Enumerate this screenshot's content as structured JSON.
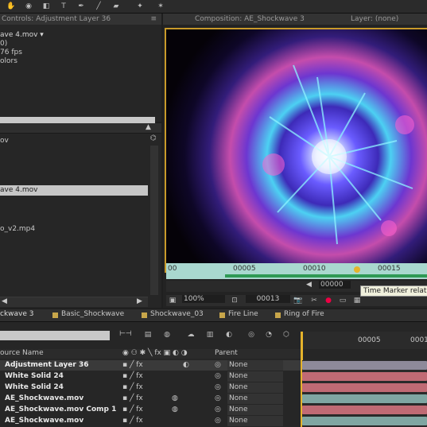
{
  "toolbar": {
    "title": ""
  },
  "effect_controls": {
    "tab_title": "Controls: Adjustment Layer 36",
    "source_name": "ave 4.mov ▾",
    "line2": "0)",
    "line3": "76 fps",
    "line4": "olors"
  },
  "project": {
    "items": [
      {
        "label": "ov"
      },
      {
        "label": "ave 4.mov",
        "selected": true
      },
      {
        "label": "o_v2.mp4"
      }
    ]
  },
  "composition": {
    "tab_title": "Composition: AE_Shockwave 3",
    "layer_label": "Layer: (none)",
    "ruler": {
      "labels": [
        "00",
        "00005",
        "00010",
        "00015"
      ]
    },
    "frame_readout": "00000",
    "tooltip": "Time Marker relative",
    "zoom": "100%",
    "timecode": "00013"
  },
  "timeline": {
    "tabs": [
      {
        "label": "ckwave 3",
        "active": true
      },
      {
        "label": "Basic_Shockwave"
      },
      {
        "label": "Shockwave_03"
      },
      {
        "label": "Fire Line"
      },
      {
        "label": "Ring of Fire"
      }
    ],
    "columns": {
      "source_name": "ource Name",
      "parent": "Parent"
    },
    "ruler": [
      "00005",
      "0001"
    ],
    "layers": [
      {
        "name": "Adjustment Layer 36",
        "parent": "None",
        "bar_color": "#8e8a9a",
        "selected": true
      },
      {
        "name": "White Solid 24",
        "parent": "None",
        "bar_color": "#c06a74"
      },
      {
        "name": "White Solid 24",
        "parent": "None",
        "bar_color": "#c06a74"
      },
      {
        "name": "AE_Shockwave.mov",
        "parent": "None",
        "bar_color": "#7fa6a2"
      },
      {
        "name": "AE_Shockwave.mov Comp 1",
        "parent": "None",
        "bar_color": "#c06a74"
      },
      {
        "name": "AE_Shockwave.mov",
        "parent": "None",
        "bar_color": "#7fa6a2"
      }
    ]
  }
}
